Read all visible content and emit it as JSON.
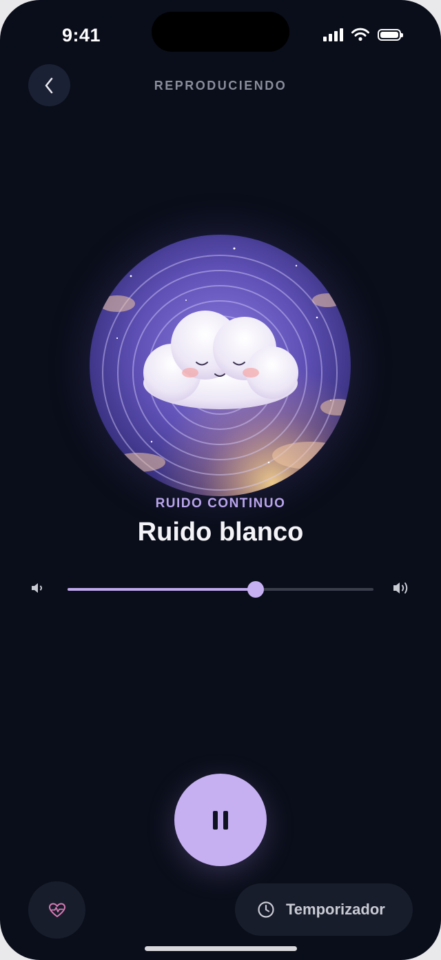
{
  "status_bar": {
    "time": "9:41"
  },
  "header": {
    "title": "REPRODUCIENDO"
  },
  "track": {
    "category": "RUIDO CONTINUO",
    "title": "Ruido blanco"
  },
  "volume": {
    "level": 0.615
  },
  "controls": {
    "timer_label": "Temporizador"
  },
  "colors": {
    "background": "#0a0e1a",
    "accent": "#c6b0f2",
    "category_text": "#b9a4ec",
    "favorite_icon": "#d97ab6"
  },
  "icons": {
    "back": "chevron-left-icon",
    "volume_low": "volume-low-icon",
    "volume_high": "volume-high-icon",
    "play_pause": "pause-icon",
    "favorite": "heart-pulse-icon",
    "timer": "clock-icon"
  }
}
